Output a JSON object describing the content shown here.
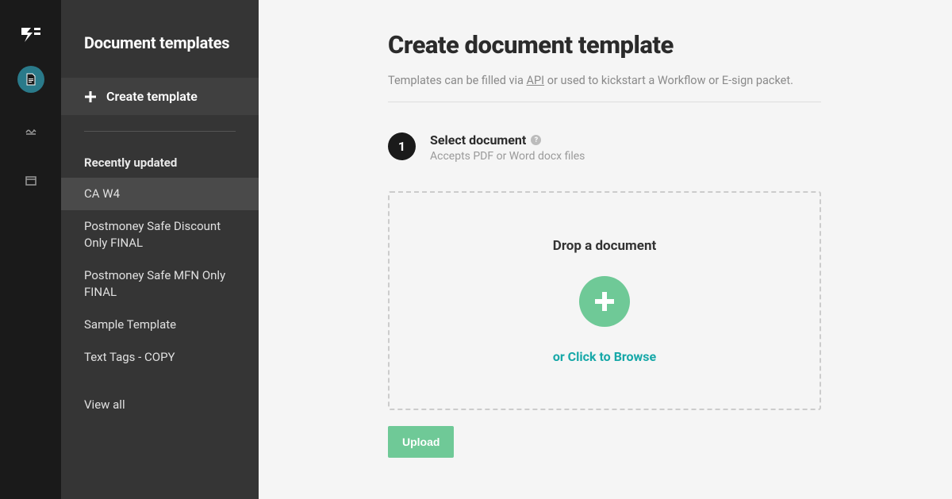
{
  "sidebar": {
    "title": "Document templates",
    "create_label": "Create template",
    "recent_heading": "Recently updated",
    "items": [
      {
        "label": "CA W4",
        "selected": true
      },
      {
        "label": "Postmoney Safe Discount Only FINAL",
        "selected": false
      },
      {
        "label": "Postmoney Safe MFN Only FINAL",
        "selected": false
      },
      {
        "label": "Sample Template",
        "selected": false
      },
      {
        "label": "Text Tags - COPY",
        "selected": false
      }
    ],
    "view_all_label": "View all"
  },
  "main": {
    "title": "Create document template",
    "subtitle_prefix": "Templates can be filled via ",
    "subtitle_link": "API",
    "subtitle_suffix": " or used to kickstart a Workflow or E-sign packet.",
    "step": {
      "number": "1",
      "title": "Select document",
      "help": "?",
      "desc": "Accepts PDF or Word docx files"
    },
    "drop": {
      "title": "Drop a document",
      "browse": "or Click to Browse"
    },
    "upload_label": "Upload"
  }
}
